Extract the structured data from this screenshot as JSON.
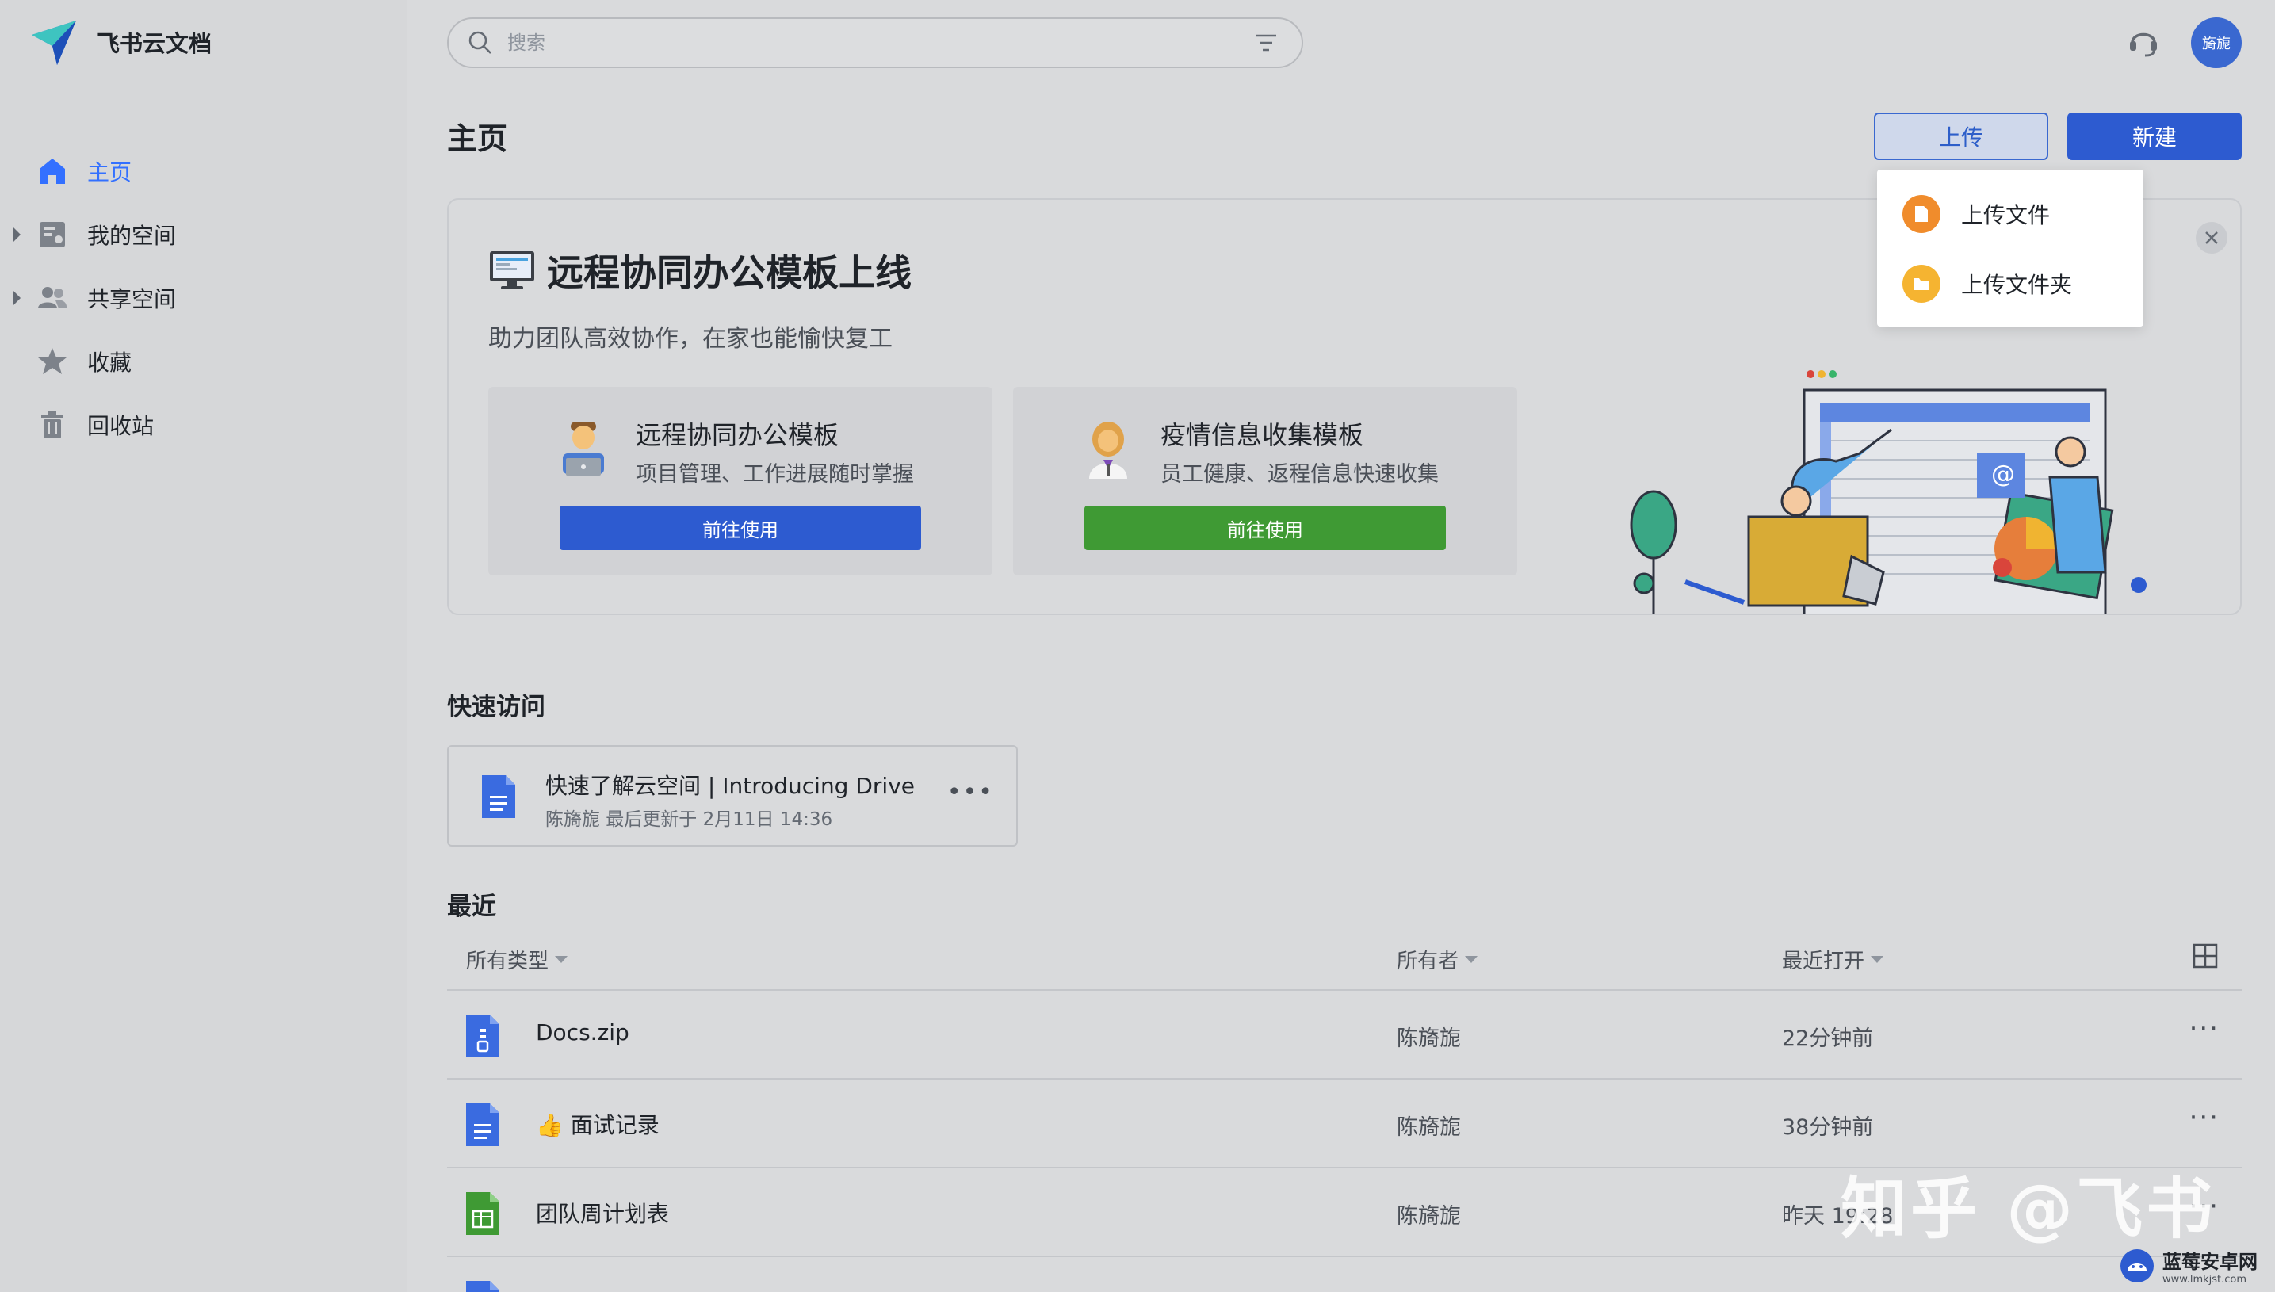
{
  "app": {
    "name": "飞书云文档"
  },
  "sidebar": {
    "items": [
      {
        "label": "主页",
        "icon": "home-icon",
        "active": true,
        "expandable": false
      },
      {
        "label": "我的空间",
        "icon": "my-space-icon",
        "active": false,
        "expandable": true
      },
      {
        "label": "共享空间",
        "icon": "shared-space-icon",
        "active": false,
        "expandable": true
      },
      {
        "label": "收藏",
        "icon": "star-icon",
        "active": false,
        "expandable": false
      },
      {
        "label": "回收站",
        "icon": "trash-icon",
        "active": false,
        "expandable": false
      }
    ]
  },
  "header": {
    "search_placeholder": "搜索",
    "avatar_text": "旖旎"
  },
  "page": {
    "title": "主页",
    "upload_label": "上传",
    "new_label": "新建"
  },
  "upload_menu": {
    "items": [
      {
        "label": "上传文件",
        "icon": "file-upload-icon",
        "color": "#f08c2c"
      },
      {
        "label": "上传文件夹",
        "icon": "folder-upload-icon",
        "color": "#f5b431"
      }
    ]
  },
  "banner": {
    "title": "远程协同办公模板上线",
    "subtitle": "助力团队高效协作，在家也能愉快复工",
    "cards": [
      {
        "title": "远程协同办公模板",
        "desc": "项目管理、工作进展随时掌握",
        "button": "前往使用",
        "color": "#2d5bd0"
      },
      {
        "title": "疫情信息收集模板",
        "desc": "员工健康、返程信息快速收集",
        "button": "前往使用",
        "color": "#3f9a34"
      }
    ]
  },
  "quick_access": {
    "title": "快速访问",
    "items": [
      {
        "title": "快速了解云空间 | Introducing Drive",
        "meta": "陈旖旎 最后更新于 2月11日 14:36"
      }
    ]
  },
  "recent": {
    "title": "最近",
    "columns": {
      "type": "所有类型",
      "owner": "所有者",
      "opened": "最近打开"
    },
    "rows": [
      {
        "name": "Docs.zip",
        "owner": "陈旖旎",
        "time": "22分钟前",
        "type": "zip"
      },
      {
        "name": "👍 面试记录",
        "owner": "陈旖旎",
        "time": "38分钟前",
        "type": "doc"
      },
      {
        "name": "团队周计划表",
        "owner": "陈旖旎",
        "time": "昨天 19:28",
        "type": "sheet"
      }
    ]
  },
  "watermark": {
    "text": "知乎 @飞书"
  },
  "corner_brand": {
    "main": "蓝莓安卓网",
    "sub": "www.lmkjst.com"
  }
}
